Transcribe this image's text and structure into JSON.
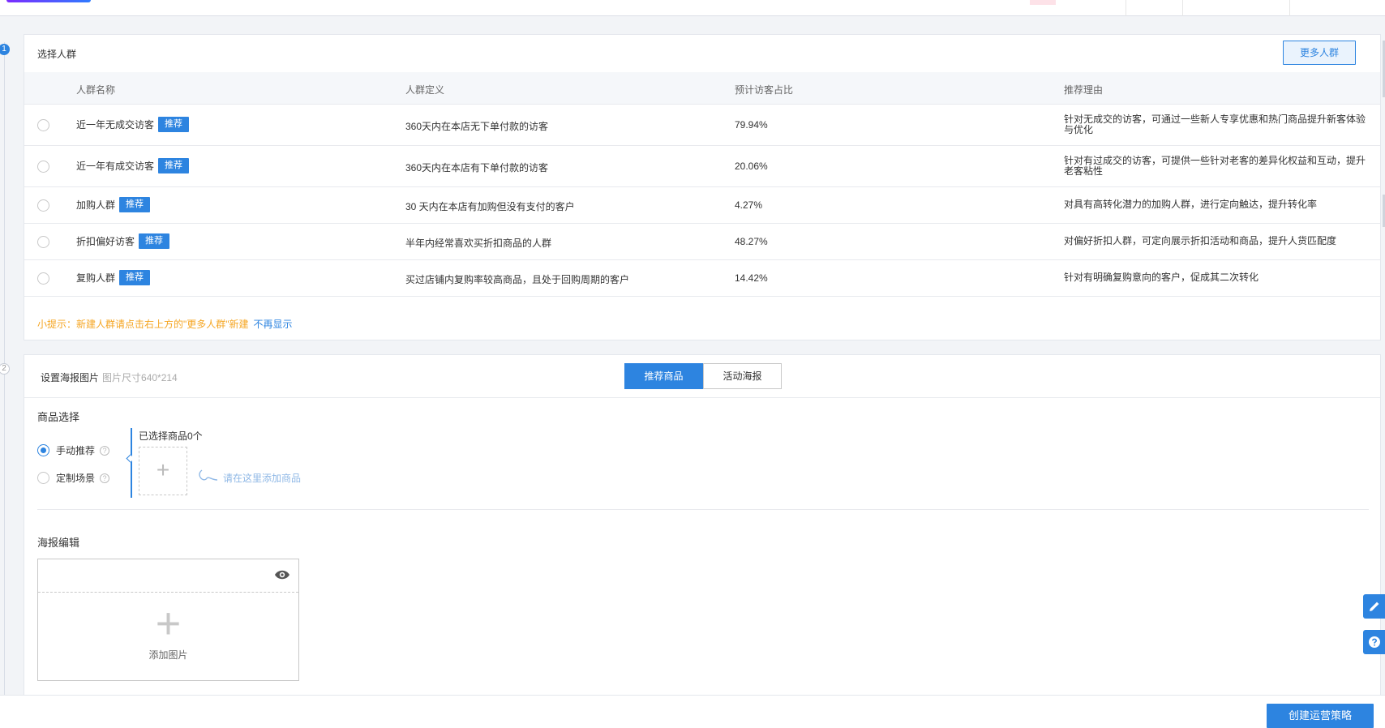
{
  "steps": {
    "step1": "1",
    "step2": "2"
  },
  "audience": {
    "title": "选择人群",
    "more_button": "更多人群",
    "columns": [
      "人群名称",
      "人群定义",
      "预计访客占比",
      "推荐理由"
    ],
    "tag_label": "推荐",
    "rows": [
      {
        "name": "近一年无成交访客",
        "definition": "360天内在本店无下单付款的访客",
        "ratio": "79.94%",
        "reason": "针对无成交的访客，可通过一些新人专享优惠和热门商品提升新客体验与优化"
      },
      {
        "name": "近一年有成交访客",
        "definition": "360天内在本店有下单付款的访客",
        "ratio": "20.06%",
        "reason": "针对有过成交的访客，可提供一些针对老客的差异化权益和互动，提升老客粘性"
      },
      {
        "name": "加购人群",
        "definition": "30 天内在本店有加购但没有支付的客户",
        "ratio": "4.27%",
        "reason": "对具有高转化潜力的加购人群，进行定向触达，提升转化率"
      },
      {
        "name": "折扣偏好访客",
        "definition": "半年内经常喜欢买折扣商品的人群",
        "ratio": "48.27%",
        "reason": "对偏好折扣人群，可定向展示折扣活动和商品，提升人货匹配度"
      },
      {
        "name": "复购人群",
        "definition": "买过店铺内复购率较高商品，且处于回购周期的客户",
        "ratio": "14.42%",
        "reason": "针对有明确复购意向的客户，促成其二次转化"
      }
    ],
    "tip": "小提示：新建人群请点击右上方的\"更多人群\"新建",
    "tip_link": "不再显示"
  },
  "poster": {
    "title": "设置海报图片",
    "size_hint": "图片尺寸640*214",
    "tabs": [
      "推荐商品",
      "活动海报"
    ],
    "product_select_label": "商品选择",
    "options": [
      "手动推荐",
      "定制场景"
    ],
    "selected_count": "已选择商品0个",
    "add_plus": "+",
    "add_hint": "请在这里添加商品",
    "edit_label": "海报编辑",
    "add_image": "添加图片"
  },
  "footer": {
    "create_button": "创建运营策略"
  },
  "colors": {
    "primary": "#2d84e0",
    "warning": "#f5a623"
  }
}
